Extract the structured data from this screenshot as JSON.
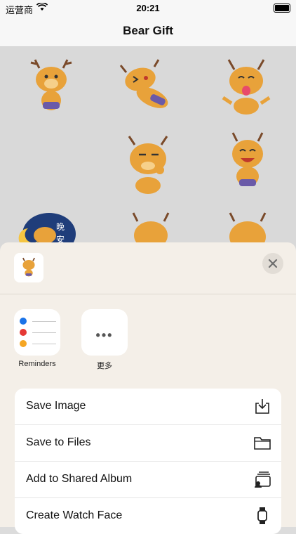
{
  "status_bar": {
    "carrier": "运营商",
    "time": "20:21"
  },
  "navbar": {
    "title": "Bear Gift"
  },
  "share_sheet": {
    "apps": [
      {
        "label": "Reminders"
      },
      {
        "label": "更多"
      }
    ],
    "actions": [
      {
        "label": "Save Image",
        "icon": "save-image-icon"
      },
      {
        "label": "Save to Files",
        "icon": "folder-icon"
      },
      {
        "label": "Add to Shared Album",
        "icon": "shared-album-icon"
      },
      {
        "label": "Create Watch Face",
        "icon": "watch-icon"
      }
    ]
  },
  "colors": {
    "accent_orange": "#e8a23a",
    "reminder_blue": "#1a73e8",
    "reminder_red": "#e53935",
    "reminder_orange": "#f5a623"
  }
}
